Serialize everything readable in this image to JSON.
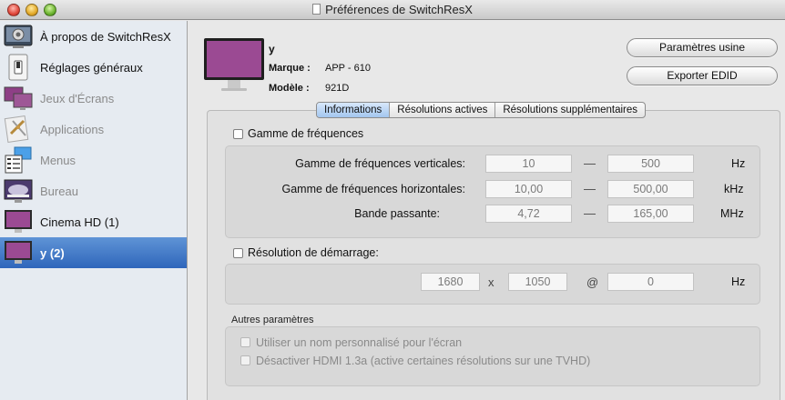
{
  "window": {
    "title": "Préférences de SwitchResX"
  },
  "sidebar": {
    "items": [
      {
        "label": "À propos de SwitchResX",
        "icon": "switchresx-app-icon",
        "state": "normal"
      },
      {
        "label": "Réglages généraux",
        "icon": "light-switch-icon",
        "state": "normal"
      },
      {
        "label": "Jeux d'Écrans",
        "icon": "display-sets-icon",
        "state": "disabled"
      },
      {
        "label": "Applications",
        "icon": "applications-icon",
        "state": "disabled"
      },
      {
        "label": "Menus",
        "icon": "menus-icon",
        "state": "disabled"
      },
      {
        "label": "Bureau",
        "icon": "desktop-icon",
        "state": "disabled"
      },
      {
        "label": "Cinema HD (1)",
        "icon": "monitor-icon",
        "state": "normal"
      },
      {
        "label": "y (2)",
        "icon": "monitor-icon",
        "state": "selected"
      }
    ]
  },
  "device": {
    "name": "y",
    "brand_label": "Marque :",
    "brand_value": "APP - 610",
    "model_label": "Modèle :",
    "model_value": "921D"
  },
  "buttons": {
    "factory": "Paramètres usine",
    "export_edid": "Exporter EDID"
  },
  "tabs": [
    {
      "label": "Informations",
      "active": true
    },
    {
      "label": "Résolutions actives",
      "active": false
    },
    {
      "label": "Résolutions supplémentaires",
      "active": false
    }
  ],
  "frequencies": {
    "checkbox_label": "Gamme de fréquences",
    "checked": false,
    "rows": [
      {
        "label": "Gamme de fréquences verticales:",
        "min": "10",
        "max": "500",
        "unit": "Hz"
      },
      {
        "label": "Gamme de fréquences horizontales:",
        "min": "10,00",
        "max": "500,00",
        "unit": "kHz"
      },
      {
        "label": "Bande passante:",
        "min": "4,72",
        "max": "165,00",
        "unit": "MHz"
      }
    ],
    "separator": "—"
  },
  "startup": {
    "checkbox_label": "Résolution de démarrage:",
    "checked": false,
    "width": "1680",
    "x_sep": "x",
    "height": "1050",
    "at_sep": "@",
    "refresh": "0",
    "unit": "Hz"
  },
  "other": {
    "title": "Autres paramètres",
    "options": [
      {
        "label": "Utiliser un nom personnalisé pour l'écran",
        "checked": false
      },
      {
        "label": "Désactiver HDMI 1.3a (active certaines résolutions sur une TVHD)",
        "checked": false
      }
    ]
  }
}
